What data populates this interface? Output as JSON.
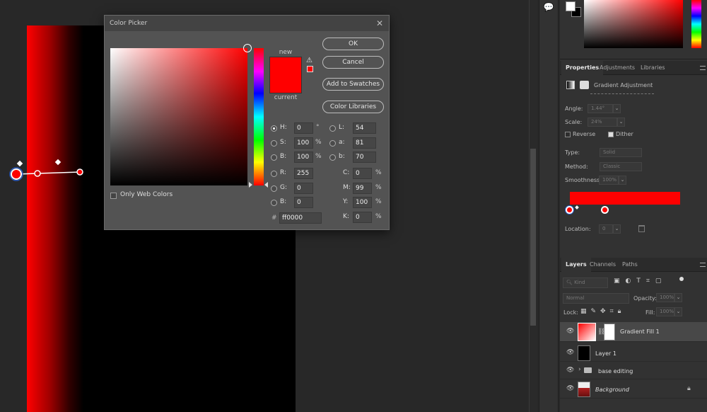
{
  "dialog": {
    "title": "Color Picker",
    "close_glyph": "✕",
    "new_label": "new",
    "current_label": "current",
    "warning_glyph": "⚠",
    "buttons": {
      "ok": "OK",
      "cancel": "Cancel",
      "add_swatches": "Add to Swatches",
      "color_libraries": "Color Libraries"
    },
    "only_web_colors": "Only Web Colors",
    "fields": {
      "H": {
        "label": "H:",
        "value": "0",
        "unit": "°"
      },
      "S": {
        "label": "S:",
        "value": "100",
        "unit": "%"
      },
      "B": {
        "label": "B:",
        "value": "100",
        "unit": "%"
      },
      "R": {
        "label": "R:",
        "value": "255"
      },
      "G": {
        "label": "G:",
        "value": "0"
      },
      "Bb": {
        "label": "B:",
        "value": "0"
      },
      "L": {
        "label": "L:",
        "value": "54"
      },
      "a": {
        "label": "a:",
        "value": "81"
      },
      "b": {
        "label": "b:",
        "value": "70"
      },
      "C": {
        "label": "C:",
        "value": "0",
        "unit": "%"
      },
      "M": {
        "label": "M:",
        "value": "99",
        "unit": "%"
      },
      "Y": {
        "label": "Y:",
        "value": "100",
        "unit": "%"
      },
      "K": {
        "label": "K:",
        "value": "0",
        "unit": "%"
      },
      "hex_label": "#",
      "hex": "ff0000"
    },
    "new_color": "#ff0000"
  },
  "properties": {
    "tabs": [
      "Properties",
      "Adjustments",
      "Libraries"
    ],
    "header": "Gradient Adjustment",
    "angle_label": "Angle:",
    "angle_value": "1.44°",
    "scale_label": "Scale:",
    "scale_value": "24%",
    "reverse_label": "Reverse",
    "dither_label": "Dither",
    "type_label": "Type:",
    "type_value": "Solid",
    "method_label": "Method:",
    "method_value": "Classic",
    "smoothness_label": "Smoothness:",
    "smoothness_value": "100%",
    "location_label": "Location:",
    "location_value": "0",
    "gradient_color": "#ff0000"
  },
  "layers": {
    "tabs": [
      "Layers",
      "Channels",
      "Paths"
    ],
    "kind_placeholder": "Kind",
    "blend_mode": "Normal",
    "opacity_label": "Opacity:",
    "opacity_value": "100%",
    "lock_label": "Lock:",
    "fill_label": "Fill:",
    "fill_value": "100%",
    "items": [
      {
        "name": "Gradient Fill 1"
      },
      {
        "name": "Layer 1"
      },
      {
        "name": "base editing"
      },
      {
        "name": "Background"
      }
    ]
  },
  "toolstrip": {
    "comment_glyph": "💬"
  },
  "accent_color": "#ff0000"
}
